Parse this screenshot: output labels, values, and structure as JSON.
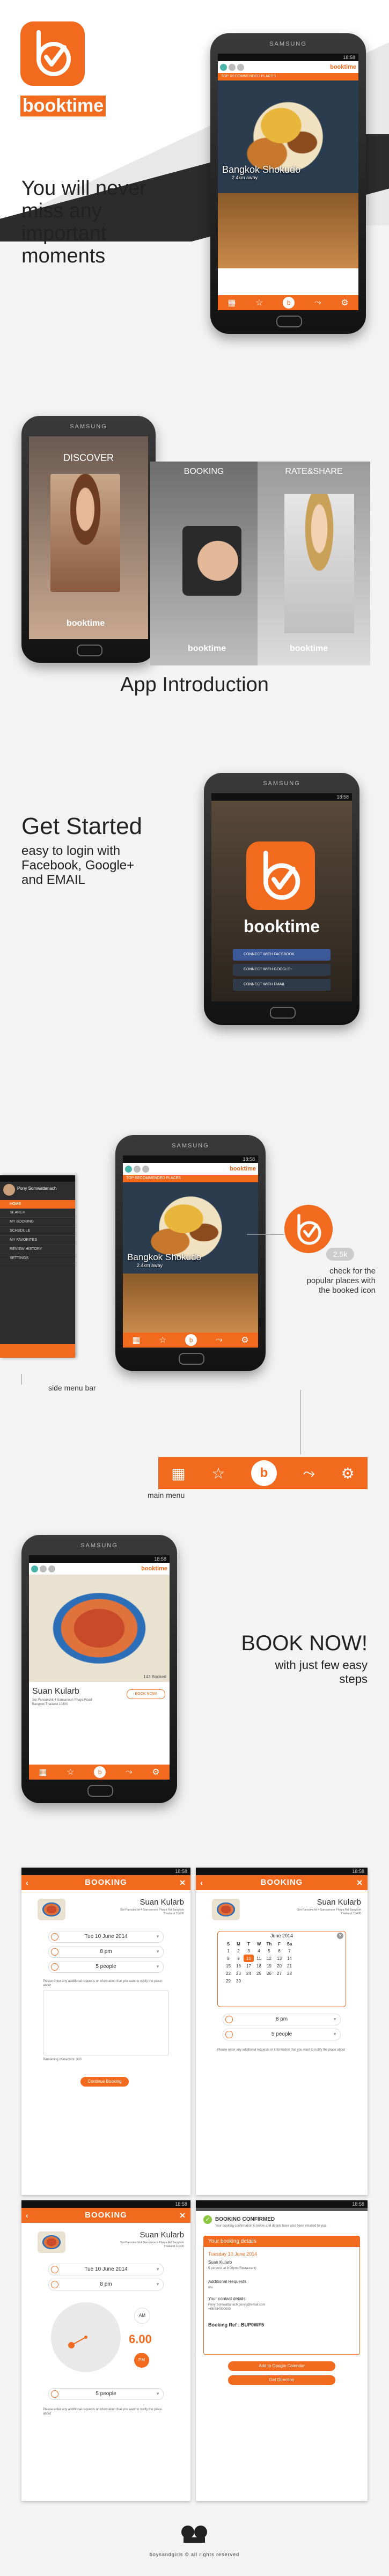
{
  "brand": {
    "name": "booktime",
    "accent": "#f26a1e"
  },
  "phone_brand": "SAMSUNG",
  "statusbar_time": "18:58",
  "hero": {
    "tagline": "You will never miss any important moments",
    "screen_header": "TOP RECOMMENDED PLACES",
    "place": "Bangkok Shokudo",
    "distance": "2.4km away"
  },
  "intro": {
    "section_title": "App Introduction",
    "panels": [
      {
        "title": "DISCOVER"
      },
      {
        "title": "BOOKING"
      },
      {
        "title": "RATE&SHARE"
      }
    ]
  },
  "get_started": {
    "title": "Get Started",
    "subtitle": "easy to login with Facebook, Google+ and EMAIL",
    "buttons": [
      "CONNECT WITH FACEBOOK",
      "CONNECT WITH GOOGLE+",
      "CONNECT WITH EMAIL"
    ]
  },
  "side_menu": {
    "user": "Pony Somwattanach",
    "items": [
      "HOME",
      "SEARCH",
      "MY BOOKING",
      "SCHEDULE",
      "MY FAVORITES",
      "REVIEW HISTORY",
      "SETTINGS"
    ],
    "caption": "side menu bar",
    "main_menu_caption": "main menu",
    "booked_count": "2.5k",
    "booked_caption": "check for the popular places with the booked icon"
  },
  "book_now": {
    "title": "BOOK NOW!",
    "subtitle": "with just few easy steps",
    "restaurant": "Suan Kularb",
    "address": "Soi Pansukchit 4 Sansanoon Phaya Road Bangkok Thailand 10400",
    "booked_badge": "143 Booked",
    "book_button": "BOOK NOW!"
  },
  "booking": {
    "header": "BOOKING",
    "restaurant": "Suan Kularb",
    "address": "Soi Pansukchit 4 Sansanoon Phaya Rd Bangkok Thailand 10400",
    "date": "Tue 10 June 2014",
    "time": "8 pm",
    "people": "5 people",
    "note": "Please enter any additional requests or information that you want to notify the place about",
    "remaining": "Remaining characters: 300",
    "continue": "Continue Booking",
    "calendar": {
      "month": "June 2014",
      "days": [
        "S",
        "M",
        "T",
        "W",
        "Th",
        "F",
        "Sa"
      ],
      "rows": [
        [
          "1",
          "2",
          "3",
          "4",
          "5",
          "6",
          "7"
        ],
        [
          "8",
          "9",
          "10",
          "11",
          "12",
          "13",
          "14"
        ],
        [
          "15",
          "16",
          "17",
          "18",
          "19",
          "20",
          "21"
        ],
        [
          "22",
          "23",
          "24",
          "25",
          "26",
          "27",
          "28"
        ],
        [
          "29",
          "30",
          "",
          "",
          "",
          "",
          ""
        ]
      ],
      "selected": "10"
    },
    "clock": {
      "time": "6.00",
      "am": "AM",
      "pm": "PM"
    }
  },
  "confirmed": {
    "banner": "BOOKING CONFIRMED",
    "note": "Your booking confirmation is below and details have also been emailed to you.",
    "panel_title": "Your booking details",
    "date": "Tuesday 10 June 2014",
    "place": "Suan Kularb",
    "people": "5 persons at 8:00pm (Restaurant)",
    "requests_label": "Additional Requests",
    "requests": "n/a",
    "contact_label": "Your contact details",
    "contact": "Pony Somwattanach ponyg@email.com +66 894000000",
    "ref": "Booking Ref : BUP0WF5",
    "btn_calendar": "Add to Google Calendar",
    "btn_direction": "Get Direction"
  },
  "footer": {
    "credit": "boysandgirls © all rights reserved"
  }
}
